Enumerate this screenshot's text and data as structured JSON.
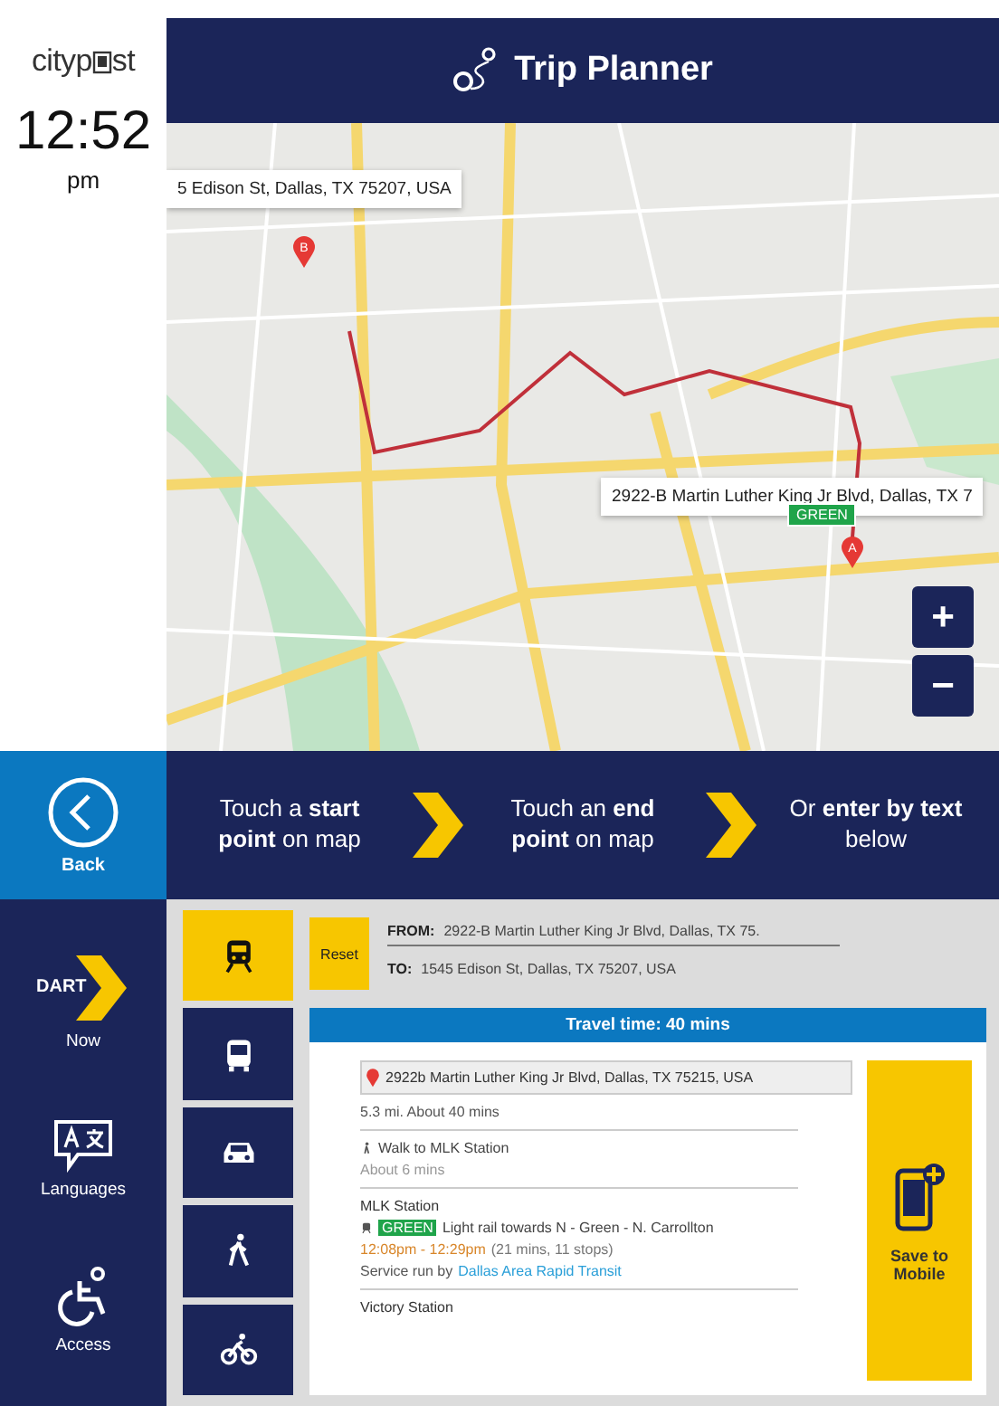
{
  "kiosk": {
    "logo_parts": [
      "cityp",
      "st"
    ],
    "time": "12:52",
    "meridiem": "pm"
  },
  "header": {
    "title": "Trip Planner"
  },
  "map": {
    "popups": [
      {
        "text": "5 Edison St, Dallas, TX 75207, USA",
        "kind": "end"
      },
      {
        "text": "2922-B Martin Luther King Jr Blvd, Dallas, TX 7",
        "kind": "start"
      }
    ],
    "pins": [
      {
        "letter": "B",
        "kind": "end"
      },
      {
        "letter": "A",
        "kind": "start"
      }
    ],
    "line_badge": "GREEN",
    "zoom_in": "+",
    "zoom_out": "−"
  },
  "back": {
    "label": "Back"
  },
  "instructions": [
    "Touch a **start** **point** on map",
    "Touch an **end** **point** on map",
    "Or **enter by** **text** below"
  ],
  "nav": [
    {
      "kind": "dart",
      "logo_text": "DART",
      "label": "Now"
    },
    {
      "kind": "languages",
      "label": "Languages"
    },
    {
      "kind": "access",
      "label": "Access"
    }
  ],
  "modes": [
    {
      "kind": "train",
      "selected": true
    },
    {
      "kind": "bus",
      "selected": false
    },
    {
      "kind": "car",
      "selected": false
    },
    {
      "kind": "walk",
      "selected": false
    },
    {
      "kind": "bike",
      "selected": false
    }
  ],
  "route": {
    "reset": "Reset",
    "from_label": "FROM:",
    "from": "2922-B Martin Luther King Jr Blvd, Dallas, TX 75.",
    "to_label": "TO:",
    "to": "1545 Edison St, Dallas, TX 75207, USA"
  },
  "trip": {
    "travel_time": "Travel time: 40 mins",
    "start_address": "2922b Martin Luther King Jr Blvd, Dallas, TX 75215, USA",
    "summary": "5.3 mi. About 40 mins",
    "steps": [
      {
        "kind": "walk",
        "title": "Walk to MLK Station",
        "detail": "About 6 mins"
      },
      {
        "kind": "transit",
        "station": "MLK Station",
        "line": "GREEN",
        "title": "Light rail towards N - Green - N. Carrollton",
        "times": "12:08pm - 12:29pm",
        "duration": "(21 mins, 11 stops)",
        "service_prefix": "Service run by",
        "service_link": "Dallas Area Rapid Transit"
      },
      {
        "kind": "station",
        "station": "Victory Station"
      }
    ],
    "save": "Save to Mobile"
  }
}
